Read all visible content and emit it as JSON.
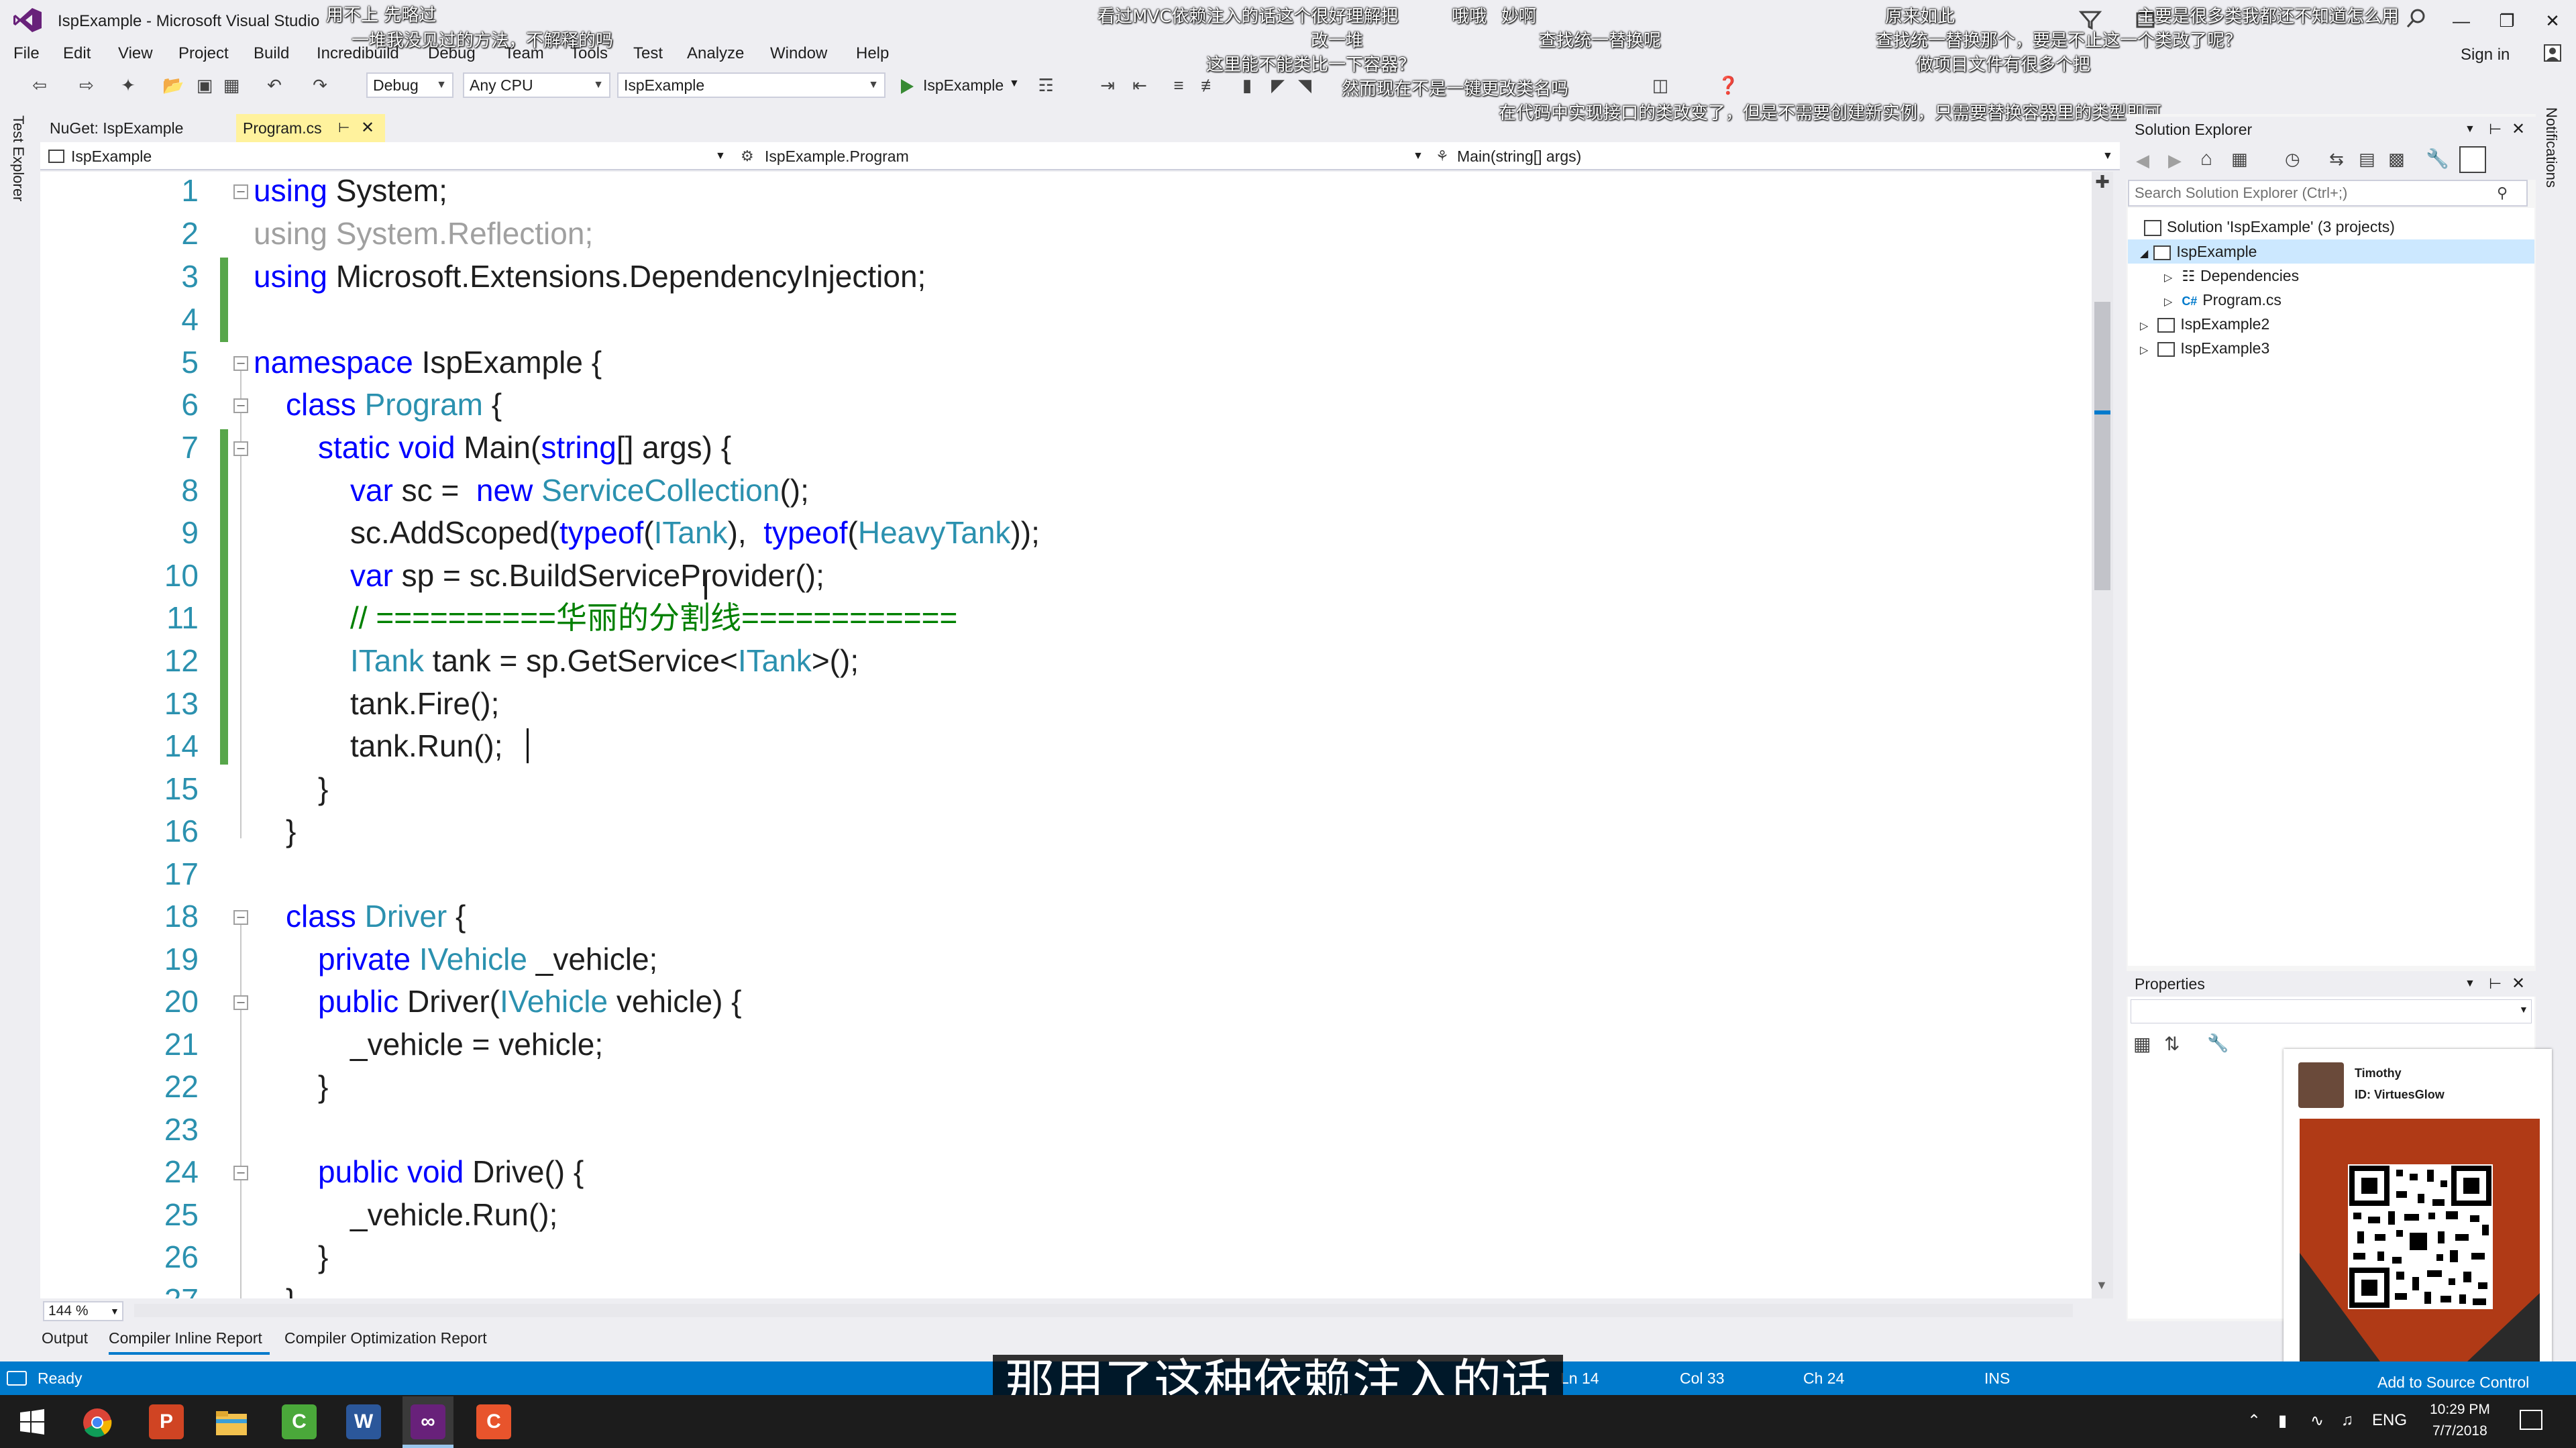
{
  "window": {
    "title": "IspExample - Microsoft Visual Studio",
    "sign_in": "Sign in"
  },
  "menu": [
    "File",
    "Edit",
    "View",
    "Project",
    "Build",
    "Incredibuild",
    "Debug",
    "Team",
    "Tools",
    "Test",
    "Analyze",
    "Window",
    "Help"
  ],
  "toolbar": {
    "config": "Debug",
    "platform": "Any CPU",
    "startup_project": "IspExample",
    "run_label": "IspExample"
  },
  "danmaku": [
    "用不上 先略过",
    "一堆我没见过的方法，不解释的吗",
    "看过MVC依赖注入的话这个很好理解把",
    "哦哦",
    "妙啊",
    "改一堆",
    "查找统一替换呢",
    "这里能不能类比一下容器？",
    "原来如此",
    "主要是很多类我都还不知道怎么用",
    "查找统一替换那个，要是不止这一个类改了呢？",
    "做项目文件有很多个把",
    "然而现在不是一键更改类名吗",
    "在代码中实现接口的类改变了，但是不需要创建新实例，只需要替换容器里的类型即可"
  ],
  "left_strip": {
    "label": "Test Explorer"
  },
  "tabs": [
    {
      "label": "NuGet: IspExample"
    },
    {
      "label": "Program.cs"
    }
  ],
  "navbar": {
    "project": "IspExample",
    "type": "IspExample.Program",
    "member": "Main(string[] args)"
  },
  "editor": {
    "zoom": "144 %",
    "line_numbers": [
      "1",
      "2",
      "3",
      "4",
      "5",
      "6",
      "7",
      "8",
      "9",
      "10",
      "11",
      "12",
      "13",
      "14",
      "15",
      "16",
      "17",
      "18",
      "19",
      "20",
      "21",
      "22",
      "23",
      "24",
      "25",
      "26",
      "27"
    ]
  },
  "bottom_tabs": [
    "Output",
    "Compiler Inline Report",
    "Compiler Optimization Report"
  ],
  "status": {
    "ready": "Ready",
    "line": "Ln 14",
    "col": "Col 33",
    "ch": "Ch 24",
    "mode": "INS",
    "add_source": "Add to Source Control"
  },
  "subtitle": "那用了这种依赖注入的话",
  "solution_explorer": {
    "title": "Solution Explorer",
    "search_placeholder": "Search Solution Explorer (Ctrl+;)",
    "nodes": [
      {
        "label": "Solution 'IspExample' (3 projects)"
      },
      {
        "label": "IspExample"
      },
      {
        "label": "Dependencies"
      },
      {
        "label": "Program.cs"
      },
      {
        "label": "IspExample2"
      },
      {
        "label": "IspExample3"
      }
    ]
  },
  "properties": {
    "title": "Properties"
  },
  "notifications": {
    "label": "Notifications"
  },
  "profile_card": {
    "name": "Timothy",
    "id": "ID: VirtuesGlow"
  },
  "taskbar": {
    "language": "ENG",
    "time": "10:29 PM",
    "date": "7/7/2018",
    "apps": [
      "start-icon",
      "chrome-icon",
      "powerpoint-icon",
      "file-explorer-icon",
      "camtasia-icon",
      "word-icon",
      "visual-studio-icon",
      "camtasia-recorder-icon"
    ]
  },
  "colors": {
    "keyword": "#0000ff",
    "type": "#2b91af",
    "comment": "#008000",
    "line_number": "#2b91af",
    "status_bar": "#007acc",
    "active_tab": "#fff29d"
  }
}
